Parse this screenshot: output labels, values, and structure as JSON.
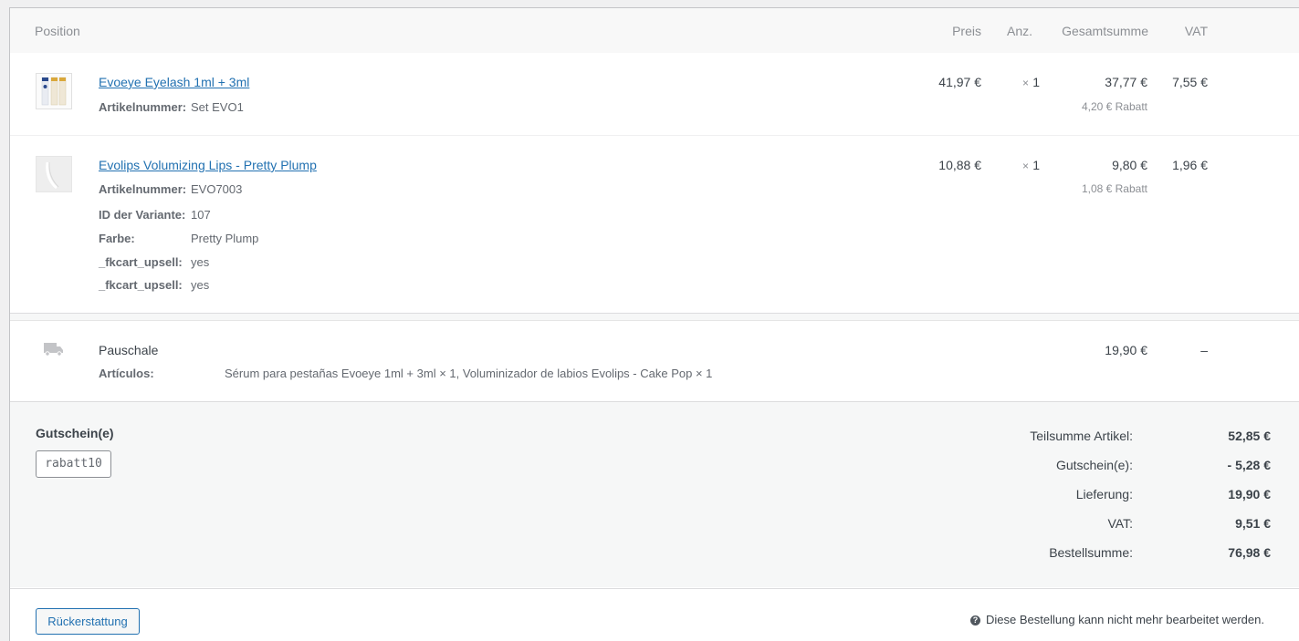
{
  "table_header": {
    "position": "Position",
    "price": "Preis",
    "qty": "Anz.",
    "total": "Gesamtsumme",
    "vat": "VAT"
  },
  "items": [
    {
      "name": "Evoeye Eyelash 1ml + 3ml",
      "meta": [
        {
          "label": "Artikelnummer:",
          "value": "Set EVO1"
        }
      ],
      "price": "41,97 €",
      "qty_symbol": "×",
      "qty": "1",
      "total": "37,77 €",
      "discount": "4,20 € Rabatt",
      "vat": "7,55 €"
    },
    {
      "name": "Evolips Volumizing Lips - Pretty Plump",
      "meta": [
        {
          "label": "Artikelnummer:",
          "value": "EVO7003"
        },
        {
          "label": "ID der Variante:",
          "value": "107"
        },
        {
          "label": "Farbe:",
          "value": "Pretty Plump"
        },
        {
          "label": "_fkcart_upsell:",
          "value": "yes"
        },
        {
          "label": "_fkcart_upsell:",
          "value": "yes"
        }
      ],
      "price": "10,88 €",
      "qty_symbol": "×",
      "qty": "1",
      "total": "9,80 €",
      "discount": "1,08 € Rabatt",
      "vat": "1,96 €"
    }
  ],
  "shipping": {
    "icon": "truck-icon",
    "name": "Pauschale",
    "items_label": "Artículos:",
    "items_value": "Sérum para pestañas Evoeye 1ml + 3ml × 1, Voluminizador de labios Evolips - Cake Pop × 1",
    "total": "19,90 €",
    "vat": "–"
  },
  "coupons": {
    "title": "Gutschein(e)",
    "code": "rabatt10"
  },
  "totals": [
    {
      "label": "Teilsumme Artikel:",
      "value": "52,85 €"
    },
    {
      "label": "Gutschein(e):",
      "value": "- 5,28 €"
    },
    {
      "label": "Lieferung:",
      "value": "19,90 €"
    },
    {
      "label": "VAT:",
      "value": "9,51 €"
    },
    {
      "label": "Bestellsumme:",
      "value": "76,98 €"
    }
  ],
  "footer": {
    "refund_button": "Rückerstattung",
    "help_icon": "help-icon",
    "notice": "Diese Bestellung kann nicht mehr bearbeitet werden."
  }
}
